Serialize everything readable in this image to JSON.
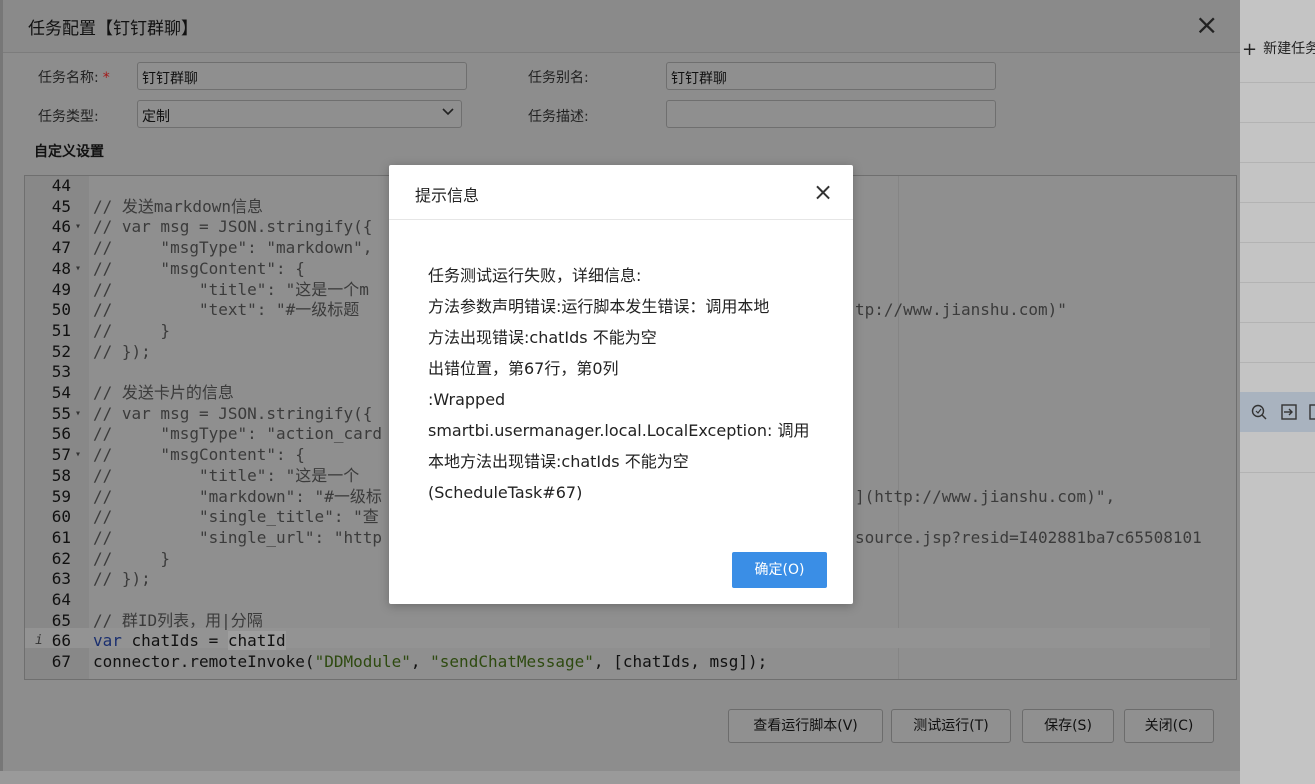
{
  "background": {
    "new_task_label": "新建任务",
    "plus_icon": "plus-icon"
  },
  "dialog": {
    "title": "任务配置【钉钉群聊】",
    "close_label": "×",
    "fields": {
      "task_name_label": "任务名称:",
      "task_name_required": "*",
      "task_name_value": "钉钉群聊",
      "task_alias_label": "任务别名:",
      "task_alias_value": "钉钉群聊",
      "task_type_label": "任务类型:",
      "task_type_value": "定制",
      "task_desc_label": "任务描述:",
      "task_desc_value": ""
    },
    "section_title": "自定义设置",
    "buttons": {
      "view_script": "查看运行脚本(V)",
      "test_run": "测试运行(T)",
      "save": "保存(S)",
      "close": "关闭(C)"
    }
  },
  "editor": {
    "lines": [
      {
        "num": "44",
        "text": ""
      },
      {
        "num": "45",
        "text": "// 发送markdown信息"
      },
      {
        "num": "46",
        "text": "// var msg = JSON.stringify({"
      },
      {
        "num": "47",
        "text": "//     \"msgType\": \"markdown\","
      },
      {
        "num": "48",
        "text": "//     \"msgContent\": {"
      },
      {
        "num": "49",
        "text": "//         \"title\": \"这是一个m"
      },
      {
        "num": "50",
        "text": "//         \"text\": \"#一级标题"
      },
      {
        "num": "51",
        "text": "//     }"
      },
      {
        "num": "52",
        "text": "// });"
      },
      {
        "num": "53",
        "text": ""
      },
      {
        "num": "54",
        "text": "// 发送卡片的信息"
      },
      {
        "num": "55",
        "text": "// var msg = JSON.stringify({"
      },
      {
        "num": "56",
        "text": "//     \"msgType\": \"action_card"
      },
      {
        "num": "57",
        "text": "//     \"msgContent\": {"
      },
      {
        "num": "58",
        "text": "//         \"title\": \"这是一个"
      },
      {
        "num": "59",
        "text": "//         \"markdown\": \"#一级标"
      },
      {
        "num": "60",
        "text": "//         \"single_title\": \"查"
      },
      {
        "num": "61",
        "text": "//         \"single_url\": \"http"
      },
      {
        "num": "62",
        "text": "//     }"
      },
      {
        "num": "63",
        "text": "// });"
      },
      {
        "num": "64",
        "text": ""
      },
      {
        "num": "65",
        "text": "// 群ID列表，用|分隔"
      },
      {
        "num": "66",
        "text": ""
      },
      {
        "num": "67",
        "text": ""
      }
    ],
    "overflow": {
      "l50": "tp://www.jianshu.com)\"",
      "l59": "](http://www.jianshu.com)\",",
      "l61": "source.jsp?resid=I402881ba7c65508101"
    },
    "line66": {
      "kw": "var",
      "mid": " chatIds = ",
      "word": "chatId"
    },
    "line67": {
      "a": "connector.remoteInvoke(",
      "s1": "\"DDModule\"",
      "c1": ", ",
      "s2": "\"sendChatMessage\"",
      "b": ", [chatIds, msg]);"
    },
    "info_marker": "i"
  },
  "modal": {
    "title": "提示信息",
    "close_label": "×",
    "message_lines": [
      "任务测试运行失败，详细信息:",
      "方法参数声明错误:运行脚本发生错误：调用本地",
      "方法出现错误:chatIds 不能为空",
      "出错位置，第67行，第0列",
      ":Wrapped",
      "smartbi.usermanager.local.LocalException: 调用",
      "本地方法出现错误:chatIds 不能为空",
      "(ScheduleTask#67)"
    ],
    "ok_label": "确定(O)"
  },
  "colors": {
    "accent": "#3a8ee6",
    "required": "#a31818"
  }
}
